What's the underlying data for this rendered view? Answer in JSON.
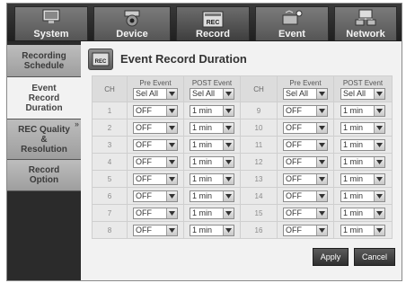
{
  "tabs": [
    {
      "label": "System",
      "icon": "monitor-icon"
    },
    {
      "label": "Device",
      "icon": "camera-icon"
    },
    {
      "label": "Record",
      "icon": "rec-icon",
      "active": true
    },
    {
      "label": "Event",
      "icon": "alarm-icon"
    },
    {
      "label": "Network",
      "icon": "network-icon"
    }
  ],
  "sidebar": {
    "items": [
      {
        "label": "Recording\nSchedule"
      },
      {
        "label": "Event\nRecord\nDuration",
        "active": true
      },
      {
        "label": "REC Quality\n&\nResolution"
      },
      {
        "label": "Record\nOption"
      }
    ]
  },
  "main": {
    "title": "Event Record Duration",
    "headers": {
      "ch": "CH",
      "pre": "Pre Event",
      "post": "POST Event",
      "pre_all": "Sel All",
      "post_all": "Sel All"
    },
    "rows": [
      {
        "ch_left": "1",
        "pre_left": "OFF",
        "post_left": "1 min",
        "ch_right": "9",
        "pre_right": "OFF",
        "post_right": "1 min"
      },
      {
        "ch_left": "2",
        "pre_left": "OFF",
        "post_left": "1 min",
        "ch_right": "10",
        "pre_right": "OFF",
        "post_right": "1 min"
      },
      {
        "ch_left": "3",
        "pre_left": "OFF",
        "post_left": "1 min",
        "ch_right": "11",
        "pre_right": "OFF",
        "post_right": "1 min"
      },
      {
        "ch_left": "4",
        "pre_left": "OFF",
        "post_left": "1 min",
        "ch_right": "12",
        "pre_right": "OFF",
        "post_right": "1 min"
      },
      {
        "ch_left": "5",
        "pre_left": "OFF",
        "post_left": "1 min",
        "ch_right": "13",
        "pre_right": "OFF",
        "post_right": "1 min"
      },
      {
        "ch_left": "6",
        "pre_left": "OFF",
        "post_left": "1 min",
        "ch_right": "14",
        "pre_right": "OFF",
        "post_right": "1 min"
      },
      {
        "ch_left": "7",
        "pre_left": "OFF",
        "post_left": "1 min",
        "ch_right": "15",
        "pre_right": "OFF",
        "post_right": "1 min"
      },
      {
        "ch_left": "8",
        "pre_left": "OFF",
        "post_left": "1 min",
        "ch_right": "16",
        "pre_right": "OFF",
        "post_right": "1 min"
      }
    ]
  },
  "buttons": {
    "apply": "Apply",
    "cancel": "Cancel"
  }
}
